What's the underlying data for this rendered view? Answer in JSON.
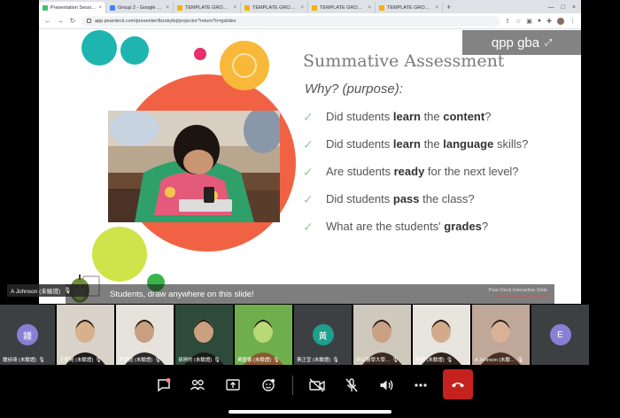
{
  "browser": {
    "tabs": [
      {
        "title": "Presentation Session - Pear Deck",
        "color": "#3fbf6f",
        "active": true
      },
      {
        "title": "Group 2 - Google Drive",
        "color": "#4285f4",
        "active": false
      },
      {
        "title": "TEMPLATE GROUP 4 - EMI C",
        "color": "#f4b400",
        "active": false
      },
      {
        "title": "TEMPLATE GROUP 3 - EMI C",
        "color": "#f4b400",
        "active": false
      },
      {
        "title": "TEMPLATE GROUP 2 - EMI C",
        "color": "#f4b400",
        "active": false
      },
      {
        "title": "TEMPLATE GROUP 1 - EMI C",
        "color": "#f4b400",
        "active": false
      }
    ],
    "url": "app.peardeck.com/presenter/tbzskyfej/projector?returnTo=gslides"
  },
  "slide": {
    "title": "Summative Assessment",
    "subtitle": "Why? (purpose):",
    "questions": [
      [
        {
          "t": "Did students "
        },
        {
          "t": "learn",
          "b": true
        },
        {
          "t": " the "
        },
        {
          "t": "content",
          "b": true
        },
        {
          "t": "?"
        }
      ],
      [
        {
          "t": "Did students "
        },
        {
          "t": "learn",
          "b": true
        },
        {
          "t": " the "
        },
        {
          "t": "language",
          "b": true
        },
        {
          "t": " skills?"
        }
      ],
      [
        {
          "t": "Are students "
        },
        {
          "t": "ready",
          "b": true
        },
        {
          "t": " for the next level?"
        }
      ],
      [
        {
          "t": "Did students "
        },
        {
          "t": "pass",
          "b": true
        },
        {
          "t": " the class?"
        }
      ],
      [
        {
          "t": "What are the students' "
        },
        {
          "t": "grades",
          "b": true
        },
        {
          "t": "?"
        }
      ]
    ],
    "banner_text": "Students, draw anywhere on this slide!",
    "brand_title": "Pear Deck Interactive Slide",
    "brand_sub": "Do not remove this bar"
  },
  "watermark": "qpp gba",
  "presenter_label": "A Johnson (未驗證)",
  "participants": [
    {
      "name": "鍾詩琦 (未驗證)",
      "kind": "letter",
      "letter": "鍾",
      "color": "#8a7fd4"
    },
    {
      "name": "王郁晃 (未驗證)",
      "kind": "video"
    },
    {
      "name": "李宜庭 (未驗證)",
      "kind": "video"
    },
    {
      "name": "孫婷的 (未驗證)",
      "kind": "video"
    },
    {
      "name": "黃國書 (未驗證)",
      "kind": "video"
    },
    {
      "name": "黃正宜 (未驗證)",
      "kind": "letter",
      "letter": "黃",
      "color": "#1e9e8c"
    },
    {
      "name": "中山醫學大學…",
      "kind": "video"
    },
    {
      "name": "李炳 (未驗證)",
      "kind": "video"
    },
    {
      "name": "A Johnson (未驗…",
      "kind": "video"
    },
    {
      "name": "",
      "kind": "letter",
      "letter": "E",
      "color": "#8a7fd4"
    }
  ]
}
